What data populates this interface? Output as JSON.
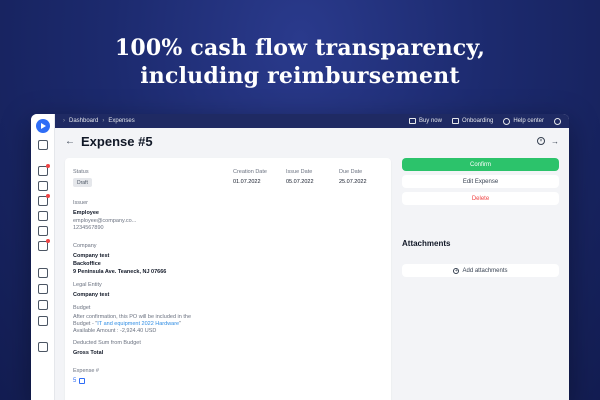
{
  "hero": {
    "line1": "100% cash flow transparency,",
    "line2": "including reimbursement"
  },
  "topbar": {
    "breadcrumb": [
      "Dashboard",
      "Expenses"
    ],
    "buy_now": "Buy now",
    "onboarding": "Onboarding",
    "help_center": "Help center"
  },
  "page": {
    "title": "Expense #5"
  },
  "details": {
    "status_label": "Status",
    "status_value": "Draft",
    "creation_date_label": "Creation Date",
    "creation_date": "01.07.2022",
    "issue_date_label": "Issue Date",
    "issue_date": "05.07.2022",
    "due_date_label": "Due Date",
    "due_date": "25.07.2022",
    "issuer_label": "Issuer",
    "issuer_role": "Employee",
    "issuer_email": "employee@company.co...",
    "issuer_phone": "1234567890",
    "company_label": "Company",
    "company_name": "Company test",
    "company_dept": "Backoffice",
    "company_address": "9 Peninsula Ave. Teaneck, NJ 07666",
    "legal_entity_label": "Legal Entity",
    "legal_entity": "Company test",
    "budget_label": "Budget",
    "budget_note_1": "After confirmation, this PO will be included in the",
    "budget_note_2_prefix": "Budget - \"",
    "budget_link": "IT and equipment 2022 Hardware",
    "budget_note_2_suffix": "\"",
    "budget_available": "Available Amount : -2,924.40 USD",
    "deducted_label": "Deducted Sum from Budget",
    "gross_total_label": "Gross Total",
    "expense_num_label": "Expense #",
    "expense_num": "5"
  },
  "actions": {
    "confirm": "Confirm",
    "edit": "Edit Expense",
    "delete": "Delete"
  },
  "attachments": {
    "title": "Attachments",
    "add": "Add attachments"
  },
  "colors": {
    "accent": "#2f6df6",
    "confirm": "#2cc36b",
    "danger": "#ef4444",
    "topbar": "#1f2a63"
  }
}
